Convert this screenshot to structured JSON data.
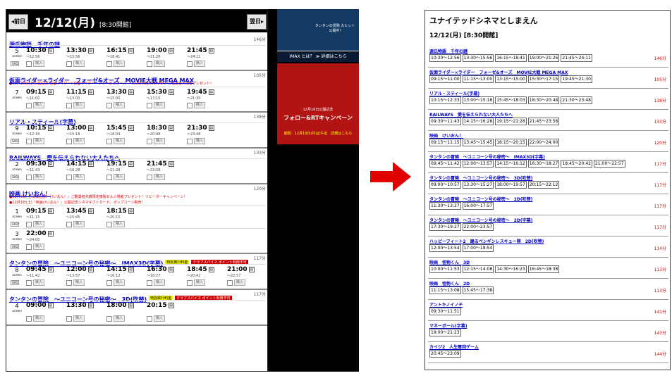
{
  "left_panel": {
    "prev_label": "◂前日",
    "next_label": "翌日▸",
    "date": "12/12(月)",
    "open_time": "[8:30開館]",
    "movies": [
      {
        "title": "源氏物語　千年の謎",
        "duration": "146分",
        "badges": [],
        "notes": [],
        "rows": [
          {
            "screen": "5",
            "srd": "SRD",
            "slots": [
              {
                "start": "10:30",
                "end": "～12:56"
              },
              {
                "start": "13:30",
                "end": "～15:56"
              },
              {
                "start": "16:15",
                "end": "～18:41"
              },
              {
                "start": "19:00",
                "end": "～21:26"
              },
              {
                "start": "21:45",
                "end": "～24:11"
              }
            ]
          }
        ]
      },
      {
        "title": "仮面ライダー×ライダー　フォーゼ&オーズ　MOVIE大戦 MEGA MAX",
        "duration": "105分",
        "badges": [],
        "notes": [
          "●12月10日(土)公開記念 仮面ライダー×仮面ライダー　フォーゼ＆オーズ　MOVIE大戦MEGAMAX ご鑑賞者入場者プレゼント！"
        ],
        "rows": [
          {
            "screen": "7",
            "srd": "",
            "slots": [
              {
                "start": "09:15",
                "end": "～11:00"
              },
              {
                "start": "11:15",
                "end": "～13:00"
              },
              {
                "start": "13:30",
                "end": "～15:00"
              },
              {
                "start": "15:30",
                "end": "～17:15"
              },
              {
                "start": "19:45",
                "end": "～21:30"
              }
            ]
          }
        ]
      },
      {
        "title": "リアル・スティール(字幕)",
        "duration": "138分",
        "badges": [],
        "notes": [],
        "rows": [
          {
            "screen": "9",
            "srd": "SRD",
            "slots": [
              {
                "start": "10:15",
                "end": "～12:33"
              },
              {
                "start": "13:00",
                "end": "～15:18"
              },
              {
                "start": "15:45",
                "end": "～18:03"
              },
              {
                "start": "18:30",
                "end": "～20:48"
              },
              {
                "start": "21:30",
                "end": "～23:48"
              }
            ]
          }
        ]
      },
      {
        "title": "RAILWAYS　愛を伝えられない大人たちへ",
        "duration": "133分",
        "badges": [],
        "notes": [],
        "rows": [
          {
            "screen": "2",
            "srd": "SRD",
            "slots": [
              {
                "start": "09:30",
                "end": "～11:43"
              },
              {
                "start": "14:15",
                "end": "～16:28"
              },
              {
                "start": "19:15",
                "end": "～21:28"
              },
              {
                "start": "21:45",
                "end": "～23:58"
              }
            ]
          }
        ]
      },
      {
        "title": "映画 けいおん！",
        "duration": "120分",
        "badges": [],
        "notes": [
          "●12月3日(土)公開記念『けいおん！』ご鑑賞者先着限定複製セル入場者プレゼント！リピーターキャンペーン！",
          "●12月3日(土)『映画けいおん！』公開記念シネマギフトカード、ポップコーン販売！"
        ],
        "rows": [
          {
            "screen": "1",
            "srd": "SRD",
            "slots": [
              {
                "start": "09:15",
                "end": "～11:15"
              },
              {
                "start": "13:45",
                "end": "～15:45"
              },
              {
                "start": "18:15",
                "end": "～20:15"
              }
            ]
          },
          {
            "screen": "3",
            "srd": "SRD",
            "slots": [
              {
                "start": "22:00",
                "end": "～24:00"
              }
            ]
          }
        ]
      },
      {
        "title": "タンタンの冒険　～ユニコーン号の秘密～　IMAX3D(字幕)",
        "duration": "117分",
        "badges": [
          "特別興行料金",
          "クラブスパイス ポイント利用不可"
        ],
        "notes": [],
        "rows": [
          {
            "screen": "8",
            "srd": "SRD",
            "slots": [
              {
                "start": "09:45",
                "end": "～11:42"
              },
              {
                "start": "12:00",
                "end": "～13:57"
              },
              {
                "start": "14:15",
                "end": "～16:12"
              },
              {
                "start": "16:30",
                "end": "～18:27"
              },
              {
                "start": "18:45",
                "end": "～20:42"
              },
              {
                "start": "21:00",
                "end": "～22:57"
              }
            ]
          }
        ]
      },
      {
        "title": "タンタンの冒険　～ユニコーン号の秘密～　3D(吹替)",
        "duration": "117分",
        "badges": [
          "特別興行料金",
          "クラブスパイス ポイント利用不可"
        ],
        "notes": [],
        "rows": [
          {
            "screen": "4",
            "srd": "",
            "slots": [
              {
                "start": "09:00",
                "end": ""
              },
              {
                "start": "13:30",
                "end": ""
              },
              {
                "start": "18:00",
                "end": ""
              },
              {
                "start": "20:15",
                "end": ""
              }
            ]
          }
        ]
      }
    ],
    "slot_buy_label": "購入",
    "screen_label": "screen"
  },
  "ads": {
    "ad1_text": "タンタンの冒険 大ヒット公開中!",
    "ad2_text": "IMAX とは？ ≫ 詳細はこちら",
    "ad3_sub": "12月16日公開記念",
    "ad3_main": "フォロー&RTキャンペーン",
    "ad3_note": "期間：12月19日(月)正午迄　詳細はこちら"
  },
  "right_panel": {
    "theater": "ユナイテッドシネマとしまえん",
    "date_line": "12/12(月) [8:30開館]",
    "movies": [
      {
        "title": "源氏物語　千年の謎",
        "duration": "146分",
        "times": [
          "10:30～12:56",
          "13:30～15:56",
          "16:15～18:41",
          "19:00～21:26",
          "21:45～24:11"
        ]
      },
      {
        "title": "仮面ライダー×ライダー　フォーゼ&オーズ　MOVIE大戦 MEGA MAX",
        "duration": "105分",
        "times": [
          "09:15～11:00",
          "11:15～13:00",
          "13:15～15:00",
          "15:30～17:15",
          "19:45～21:30"
        ]
      },
      {
        "title": "リアル・スティール(字幕)",
        "duration": "138分",
        "times": [
          "10:15～12:33",
          "13:00～15:18",
          "15:45～18:03",
          "18:30～20:48",
          "21:30～23:48"
        ]
      },
      {
        "title": "RAILWAYS　愛を伝えられない大人たちへ",
        "duration": "133分",
        "times": [
          "09:30～11:43",
          "14:15～16:28",
          "19:15～21:28",
          "21:45～23:58"
        ]
      },
      {
        "title": "映画　けいおん！",
        "duration": "120分",
        "times": [
          "09:15～11:15",
          "13:45～15:45",
          "18:15～20:15",
          "22:00～24:00"
        ]
      },
      {
        "title": "タンタンの冒険　～ユニコーン号の秘密～　IMAX3D(字幕)",
        "duration": "117分",
        "times": [
          "09:45～11:42",
          "12:00～13:57",
          "14:15～16:12",
          "16:30～18:27",
          "18:45～20:42",
          "21:00～22:57"
        ]
      },
      {
        "title": "タンタンの冒険　～ユニコーン号の秘密～　3D(吹替)",
        "duration": "117分",
        "times": [
          "09:00～10:57",
          "13:30～15:27",
          "18:00～19:57",
          "20:15～22:12"
        ]
      },
      {
        "title": "タンタンの冒険　～ユニコーン号の秘密～　2D(吹替)",
        "duration": "117分",
        "times": [
          "11:30～13:27",
          "16:00～17:57"
        ]
      },
      {
        "title": "タンタンの冒険　～ユニコーン号の秘密～　2D(字幕)",
        "duration": "117分",
        "times": [
          "17:30～19:27",
          "22:00～23:57"
        ]
      },
      {
        "title": "ハッピーフィート2　踊るペンギンレスキュー隊　2D(吹替)",
        "duration": "114分",
        "times": [
          "12:00～13:54",
          "17:00～18:54"
        ]
      },
      {
        "title": "映画　怪物くん　3D",
        "duration": "113分",
        "times": [
          "10:00～11:53",
          "12:15～14:08",
          "14:30～16:23",
          "16:45～18:38"
        ]
      },
      {
        "title": "映画　怪物くん　2D",
        "duration": "113分",
        "times": [
          "11:15～13:08",
          "15:45～17:38"
        ]
      },
      {
        "title": "アントキノイノチ",
        "duration": "141分",
        "times": [
          "09:30～11:51"
        ]
      },
      {
        "title": "マネーボール(字幕)",
        "duration": "143分",
        "times": [
          "19:00～21:23"
        ]
      },
      {
        "title": "カイジ2　人生奪回ゲーム",
        "duration": "144分",
        "times": [
          "20:45～23:09"
        ]
      }
    ]
  },
  "colors": {
    "arrow": "#e00000",
    "link": "#0000cc",
    "duration": "#dd0000"
  }
}
